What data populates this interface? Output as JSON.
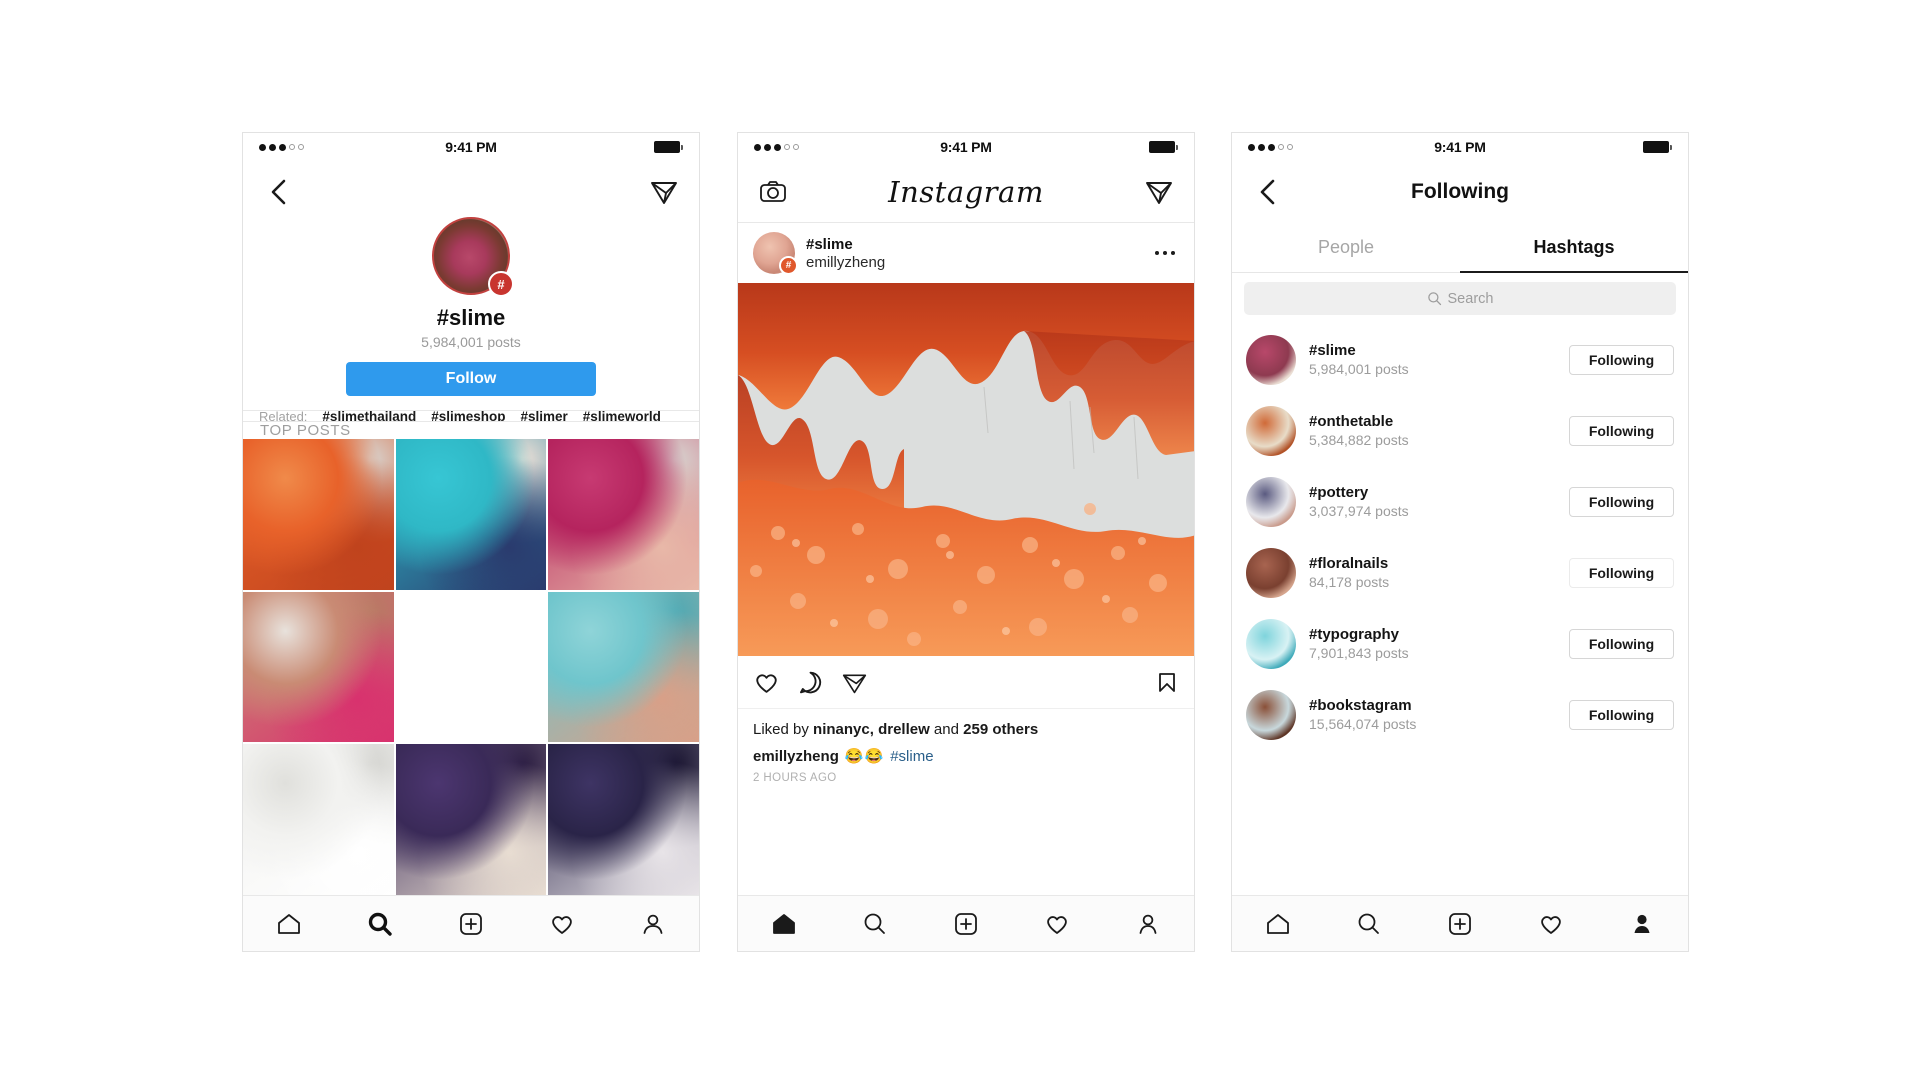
{
  "accent": {
    "follow_blue": "#2f9aed",
    "badge_red": "#c8352f",
    "link_blue": "#2a5f8a"
  },
  "statusbar": {
    "time": "9:41 PM",
    "signal_filled": 3,
    "signal_hollow": 2
  },
  "phone1": {
    "nav": {
      "back_icon": "chevron-left-icon",
      "dm_icon": "paper-plane-icon"
    },
    "profile": {
      "title": "#slime",
      "post_count": "5,984,001 posts",
      "follow_label": "Follow",
      "badge_glyph": "#"
    },
    "related": {
      "label": "Related:",
      "tags": [
        "#slimethailand",
        "#slimeshop",
        "#slimer",
        "#slimeworld"
      ]
    },
    "section_label": "TOP POSTS",
    "grid": [
      {
        "name": "orange-slime-crumbs",
        "c1": "#e8622a",
        "c2": "#f08a4a",
        "c3": "#c0431d",
        "c4": "#d8d6d2"
      },
      {
        "name": "teal-slime-stretch",
        "c1": "#2fb8c6",
        "c2": "#37c6d4",
        "c3": "#2a3b6e",
        "c4": "#f0e2d8"
      },
      {
        "name": "magenta-bowl-slime",
        "c1": "#b5245e",
        "c2": "#c73a72",
        "c3": "#e8b8a8",
        "c4": "#d8d5d0"
      },
      {
        "name": "white-slime-hands-pink",
        "c1": "#c98b74",
        "c2": "#e8e2dc",
        "c3": "#d8326e",
        "c4": "#b87a64"
      },
      {
        "name": "copper-glitter-slime",
        "c1": "#c96a42",
        "c2": "#d88css",
        "c3": "#a8502c",
        "c4": "#e08a58"
      },
      {
        "name": "blue-slime-hands",
        "c1": "#6fc5cc",
        "c2": "#8fd4d8",
        "c3": "#d8a088",
        "c4": "#4fa8b2"
      },
      {
        "name": "white-fluffy-slime",
        "c1": "#f2f2f0",
        "c2": "#e0e0dc",
        "c3": "#ffffff",
        "c4": "#d4d4d0"
      },
      {
        "name": "purple-slime-swirl",
        "c1": "#3a2a58",
        "c2": "#4c3670",
        "c3": "#e8ddd2",
        "c4": "#2a1c40"
      },
      {
        "name": "galaxy-glitter-slime",
        "c1": "#2a2448",
        "c2": "#3e3464",
        "c3": "#e8e4e8",
        "c4": "#191430"
      }
    ],
    "tabbar": {
      "active": "search",
      "items": [
        "home-icon",
        "search-icon",
        "add-post-icon",
        "heart-icon",
        "profile-icon"
      ]
    }
  },
  "phone2": {
    "nav": {
      "camera_icon": "camera-icon",
      "logo": "Instagram",
      "dm_icon": "paper-plane-icon"
    },
    "post": {
      "location_tag": "#slime",
      "username": "emillyzheng",
      "badge_glyph": "#",
      "more_icon": "more-options-icon",
      "photo_name": "orange-slime-dripping-photo",
      "actions": [
        "heart-icon",
        "comment-icon",
        "share-icon",
        "bookmark-icon"
      ],
      "liked_prefix": "Liked by ",
      "liked_names": "ninanyc, drellew",
      "liked_mid": " and ",
      "liked_count": "259 others",
      "caption_user": "emillyzheng",
      "caption_emoji": "😂😂",
      "caption_hashtag": "#slime",
      "timestamp": "2 HOURS AGO"
    },
    "tabbar": {
      "active": "home",
      "items": [
        "home-icon",
        "search-icon",
        "add-post-icon",
        "heart-icon",
        "profile-icon"
      ]
    }
  },
  "phone3": {
    "nav": {
      "back_icon": "chevron-left-icon",
      "title": "Following"
    },
    "tabs": [
      {
        "label": "People",
        "active": false
      },
      {
        "label": "Hashtags",
        "active": true
      }
    ],
    "search": {
      "placeholder": "Search",
      "icon": "search-icon"
    },
    "button_label": "Following",
    "hashtags": [
      {
        "name": "#slime",
        "count": "5,984,001 posts",
        "av1": "#b8486a",
        "av2": "#8e3a50",
        "av3": "#efe6da",
        "faded": false
      },
      {
        "name": "#onthetable",
        "count": "5,384,882 posts",
        "av1": "#d06a38",
        "av2": "#e8dcc8",
        "av3": "#b04e22",
        "faded": false
      },
      {
        "name": "#pottery",
        "count": "3,037,974 posts",
        "av1": "#5a5a80",
        "av2": "#e8e8ec",
        "av3": "#c89888",
        "faded": false
      },
      {
        "name": "#floralnails",
        "count": "84,178 posts",
        "av1": "#a86450",
        "av2": "#7a4030",
        "av3": "#d8a890",
        "faded": true
      },
      {
        "name": "#typography",
        "count": "7,901,843 posts",
        "av1": "#7fd4dc",
        "av2": "#d8f2f4",
        "av3": "#3aa8b8",
        "faded": false
      },
      {
        "name": "#bookstagram",
        "count": "15,564,074 posts",
        "av1": "#8a5038",
        "av2": "#c8d8dc",
        "av3": "#5a3020",
        "faded": false
      }
    ],
    "tabbar": {
      "active": "profile",
      "items": [
        "home-icon",
        "search-icon",
        "add-post-icon",
        "heart-icon",
        "profile-icon"
      ]
    }
  }
}
